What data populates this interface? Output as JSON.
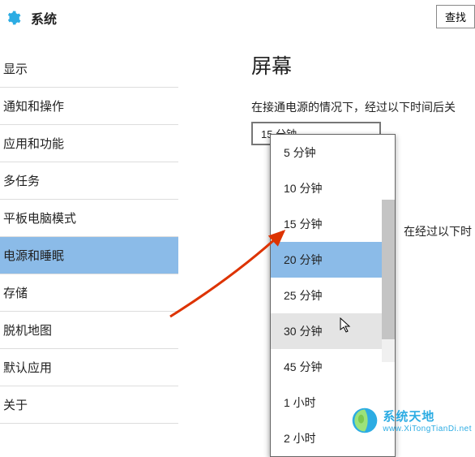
{
  "header": {
    "gear_icon": "gear",
    "title": "系统",
    "find_btn": "查找"
  },
  "sidebar": {
    "items": [
      {
        "label": "显示"
      },
      {
        "label": "通知和操作"
      },
      {
        "label": "应用和功能"
      },
      {
        "label": "多任务"
      },
      {
        "label": "平板电脑模式"
      },
      {
        "label": "电源和睡眠"
      },
      {
        "label": "存储"
      },
      {
        "label": "脱机地图"
      },
      {
        "label": "默认应用"
      },
      {
        "label": "关于"
      }
    ],
    "active_index": 5
  },
  "content": {
    "heading": "屏幕",
    "desc": "在接通电源的情况下，经过以下时间后关",
    "selected_value": "15 分钟",
    "extra_label": "在经过以下时"
  },
  "dropdown": {
    "options": [
      {
        "label": "5 分钟"
      },
      {
        "label": "10 分钟"
      },
      {
        "label": "15 分钟"
      },
      {
        "label": "20 分钟"
      },
      {
        "label": "25 分钟"
      },
      {
        "label": "30 分钟"
      },
      {
        "label": "45 分钟"
      },
      {
        "label": "1 小时"
      },
      {
        "label": "2 小时"
      }
    ],
    "highlight_index": 3,
    "hover_index": 5
  },
  "watermark": {
    "main": "系统天地",
    "sub": "www.XiTongTianDi.net"
  }
}
